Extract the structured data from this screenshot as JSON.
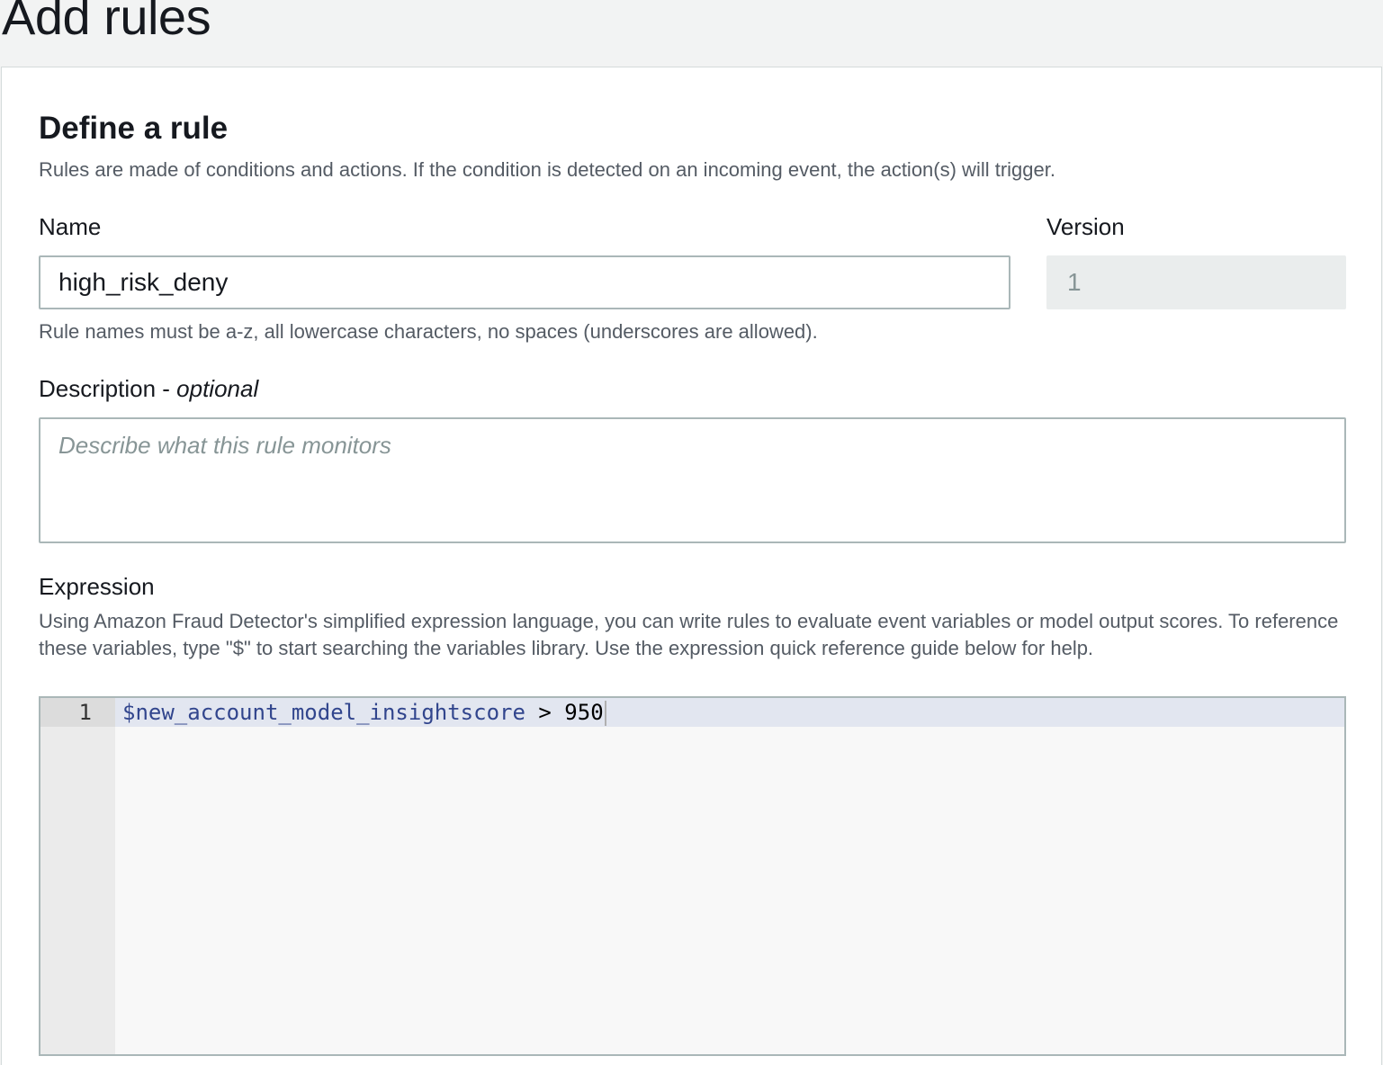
{
  "page": {
    "title": "Add rules"
  },
  "section": {
    "title": "Define a rule",
    "description": "Rules are made of conditions and actions. If the condition is detected on an incoming event, the action(s) will trigger."
  },
  "name_field": {
    "label": "Name",
    "value": "high_risk_deny",
    "hint": "Rule names must be a-z, all lowercase characters, no spaces (underscores are allowed)."
  },
  "version_field": {
    "label": "Version",
    "value": "1"
  },
  "description_field": {
    "label": "Description - ",
    "label_optional": "optional",
    "placeholder": "Describe what this rule monitors"
  },
  "expression": {
    "label": "Expression",
    "description": "Using Amazon Fraud Detector's simplified expression language, you can write rules to evaluate event variables or model output scores. To reference these variables, type \"$\" to start searching the variables library. Use the expression quick reference guide below for help.",
    "line_number": "1",
    "code_variable": "$new_account_model_insightscore",
    "code_operator": " > ",
    "code_value": "950"
  }
}
